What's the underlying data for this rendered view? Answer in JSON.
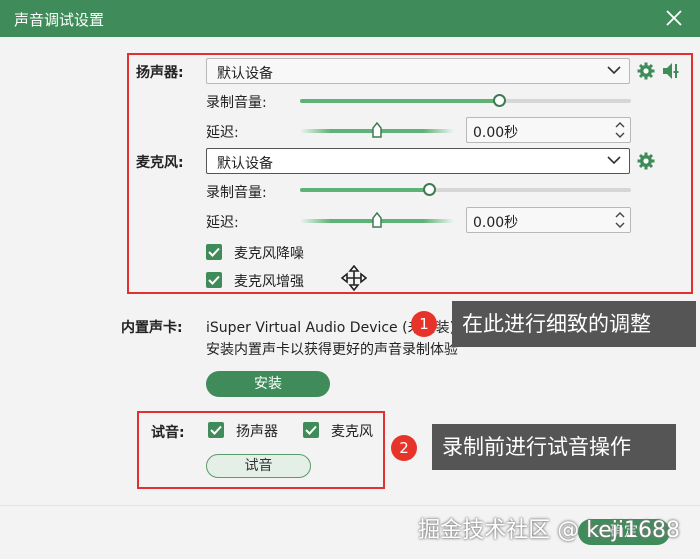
{
  "window": {
    "title": "声音调试设置"
  },
  "speaker": {
    "label": "扬声器:",
    "device": "默认设备",
    "volume_label": "录制音量:",
    "volume_level": 0.6,
    "delay_label": "延迟:",
    "delay_value": "0.00秒"
  },
  "mic": {
    "label": "麦克风:",
    "device": "默认设备",
    "volume_label": "录制音量:",
    "volume_level": 0.39,
    "delay_label": "延迟:",
    "delay_value": "0.00秒",
    "noise_label": "麦克风降噪",
    "enhance_label": "麦克风增强"
  },
  "sound_card": {
    "label": "内置声卡:",
    "device_text": "iSuper Virtual Audio Device (未安装)",
    "hint": "安装内置声卡以获得更好的声音录制体验",
    "install_label": "安装"
  },
  "test": {
    "label": "试音:",
    "speaker_label": "扬声器",
    "mic_label": "麦克风",
    "button_label": "试音"
  },
  "callouts": {
    "one_num": "1",
    "one_text": "在此进行细致的调整",
    "two_num": "2",
    "two_text": "录制前进行试音操作"
  },
  "footer": {
    "confirm_label": "确定"
  },
  "watermark": "掘金技术社区 @ keji1688",
  "colors": {
    "accent": "#3f8c5a",
    "highlight": "#e03030"
  }
}
